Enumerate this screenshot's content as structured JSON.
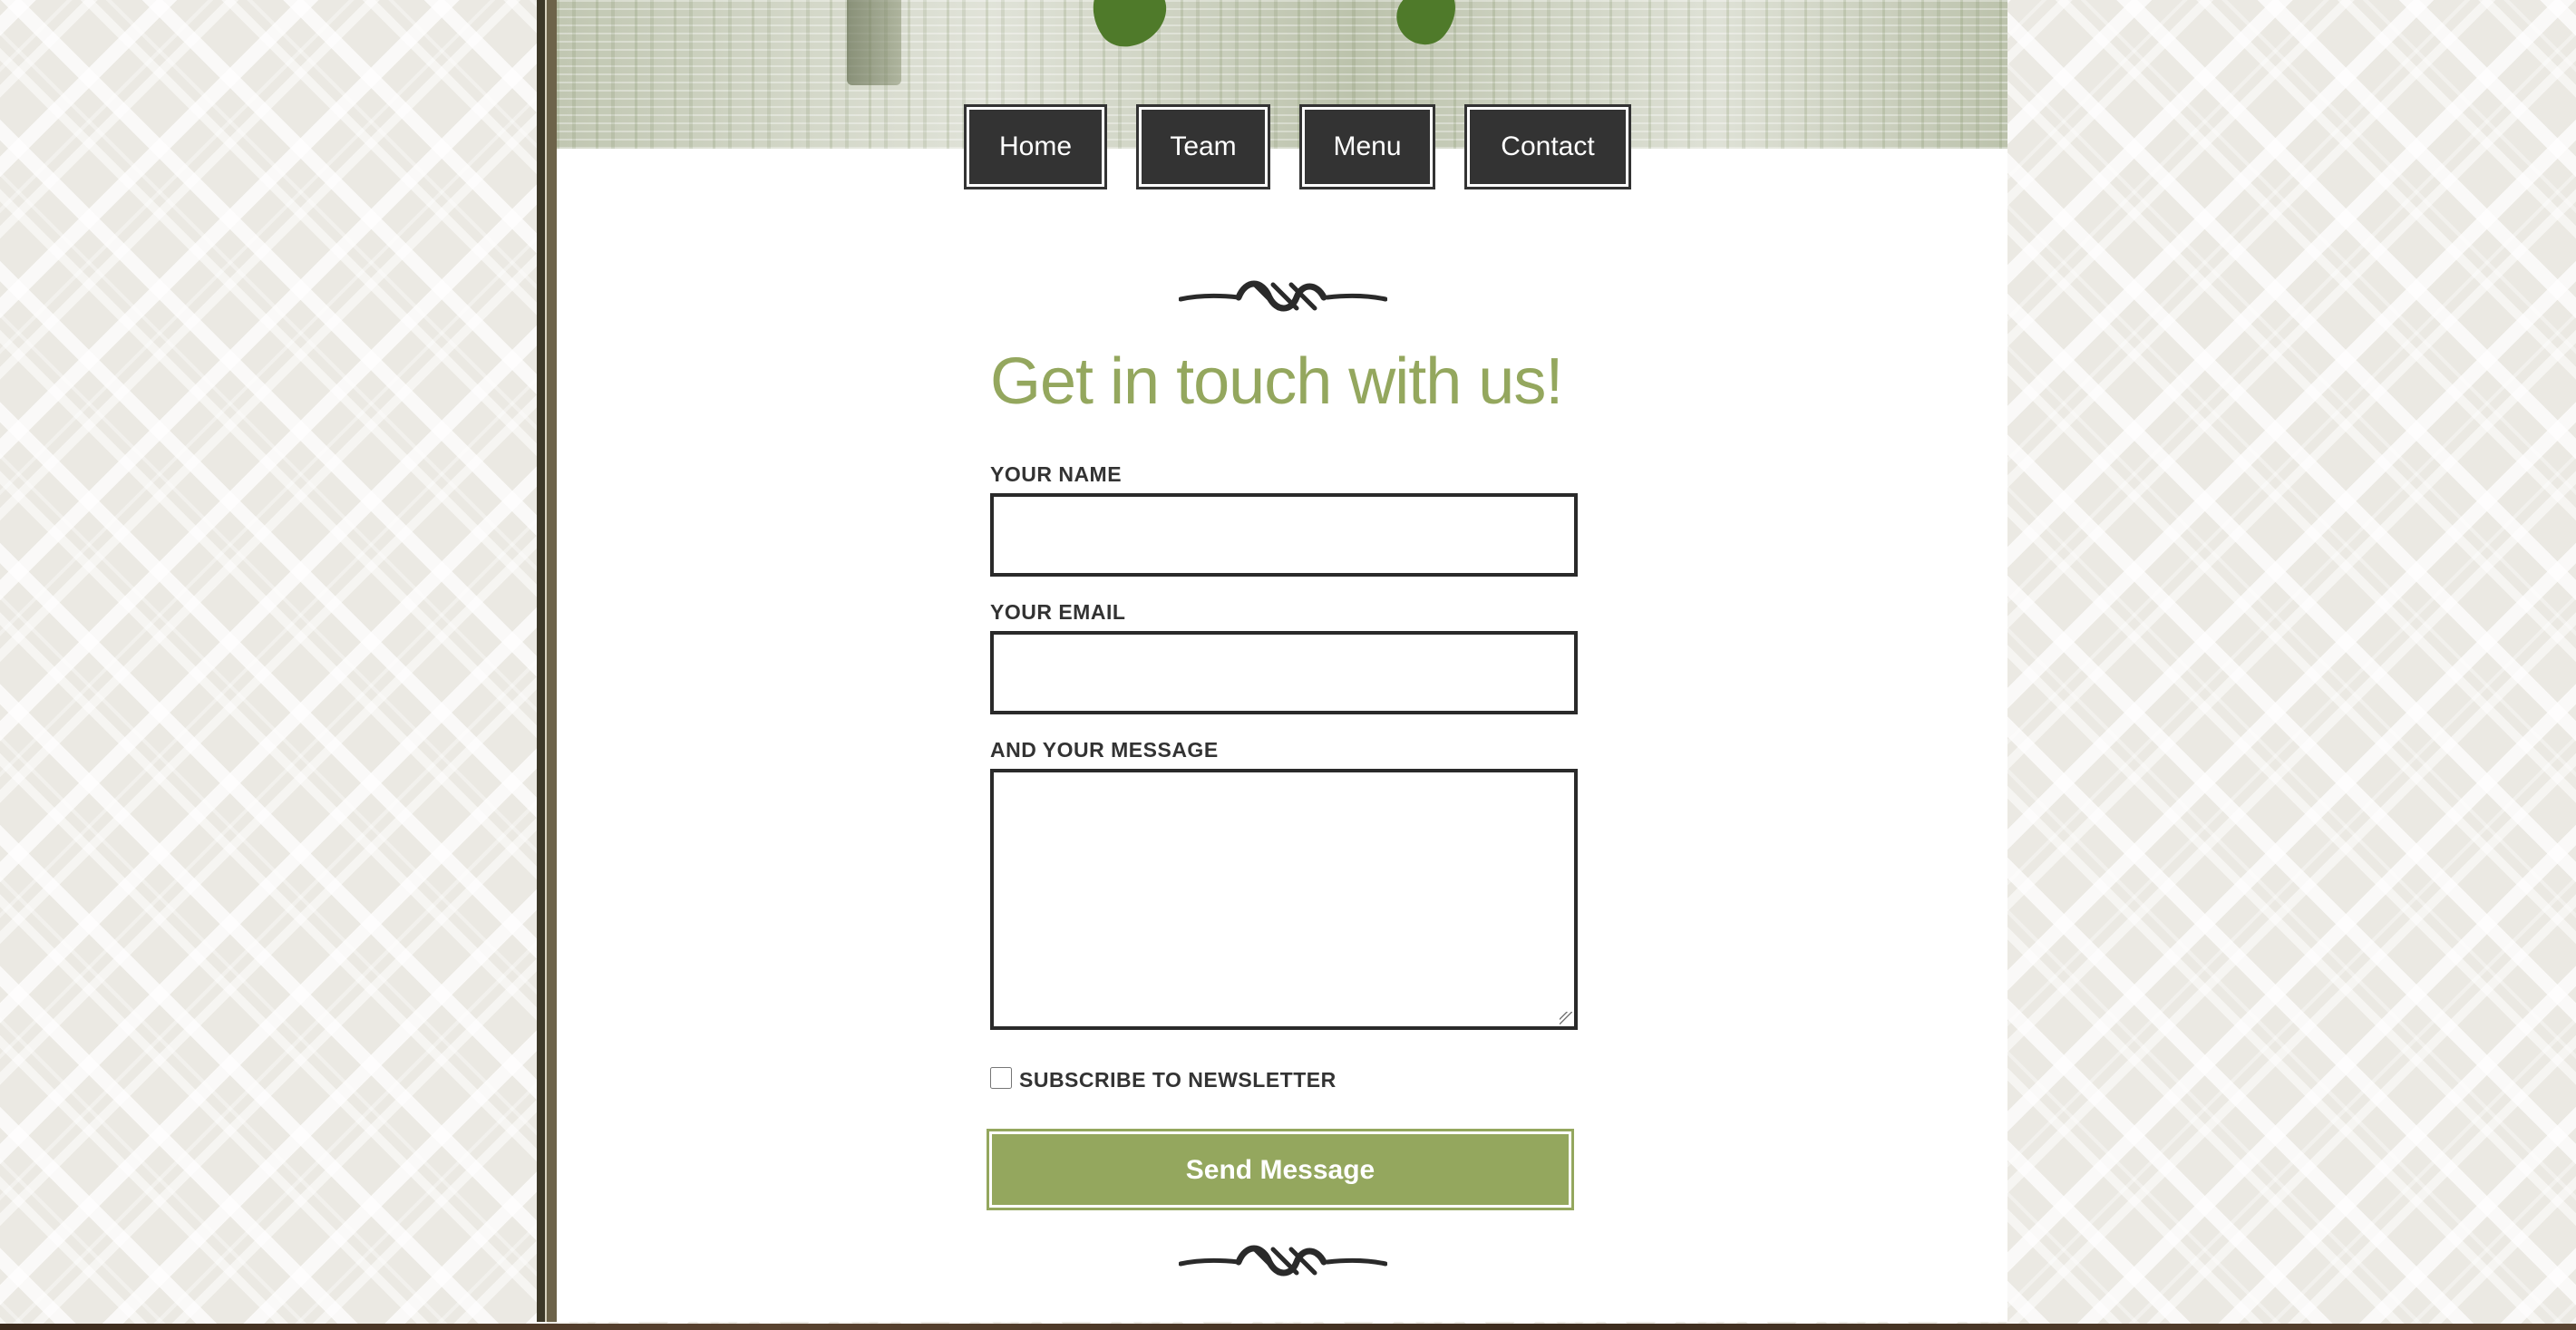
{
  "nav": {
    "items": [
      {
        "label": "Home"
      },
      {
        "label": "Team"
      },
      {
        "label": "Menu"
      },
      {
        "label": "Contact"
      }
    ]
  },
  "contact_form": {
    "heading": "Get in touch with us!",
    "name_label": "YOUR NAME",
    "name_value": "",
    "email_label": "YOUR EMAIL",
    "email_value": "",
    "message_label": "AND YOUR MESSAGE",
    "message_value": "",
    "newsletter_label": "SUBSCRIBE TO NEWSLETTER",
    "newsletter_checked": false,
    "submit_label": "Send Message"
  },
  "colors": {
    "accent_green": "#94a75e",
    "nav_button_bg": "#333333",
    "text_dark": "#333333"
  },
  "icons": {
    "divider": "ornamental-flourish-icon"
  }
}
